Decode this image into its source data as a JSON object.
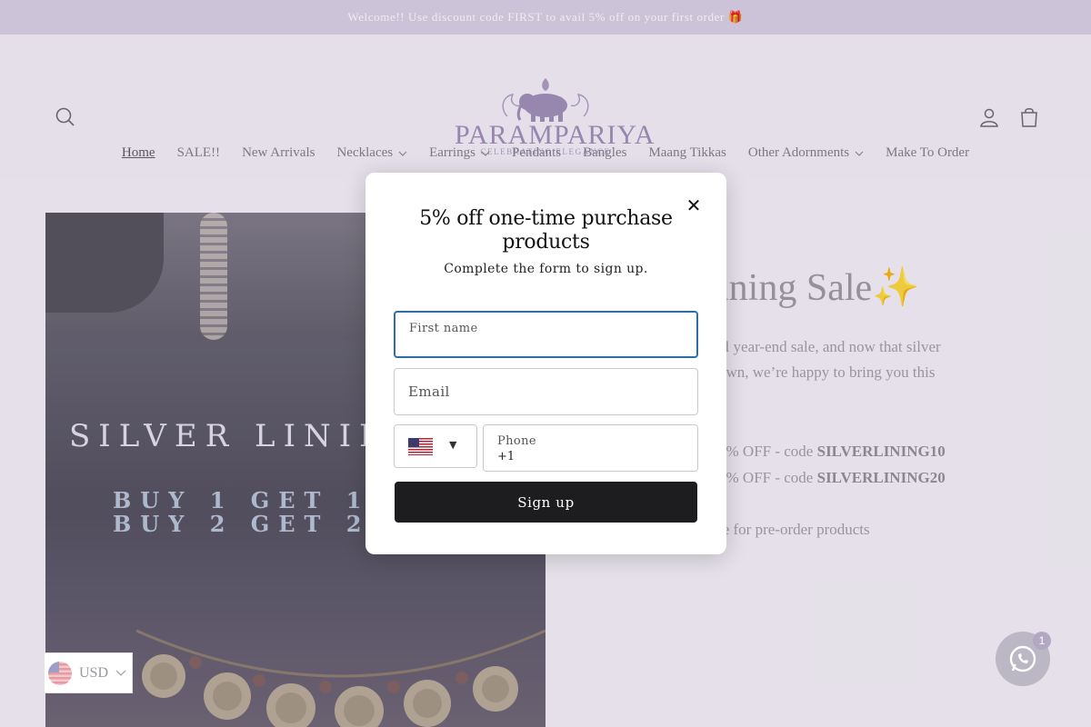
{
  "announcement": "Welcome!! Use discount code FIRST to avail 5% off on your first order 🎁",
  "header": {
    "brand": "PARAMPARIYA",
    "tagline": "CELEBRATING ELEGANCE",
    "icons": [
      "search-icon",
      "account-icon",
      "cart-icon"
    ]
  },
  "nav": {
    "items": [
      {
        "label": "Home",
        "active": true
      },
      {
        "label": "SALE!!"
      },
      {
        "label": "New Arrivals"
      },
      {
        "label": "Necklaces",
        "dropdown": true
      },
      {
        "label": "Earrings",
        "dropdown": true
      },
      {
        "label": "Pendants"
      },
      {
        "label": "Bangles"
      },
      {
        "label": "Maang Tikkas"
      },
      {
        "label": "Other Adornments",
        "dropdown": true
      },
      {
        "label": "Make To Order"
      }
    ]
  },
  "banner": {
    "title": "SILVER LINING",
    "offer_line1": "BUY 1 GET 10",
    "offer_line2": "BUY 2 GET 20"
  },
  "sale": {
    "title": "ining Sale✨",
    "line1": "al year-end sale, and now that silver",
    "line2": "own, we’re happy to bring you this",
    "code1_prefix": "0% OFF - code ",
    "code1": "SILVERLINING10",
    "code2_prefix": "0% OFF - code ",
    "code2": "SILVERLINING20",
    "note": "le for pre-order products"
  },
  "modal": {
    "title": "5% off one-time purchase products",
    "subtitle": "Complete the form to sign up.",
    "first_name_label": "First name",
    "email_label": "Email",
    "phone_label": "Phone",
    "phone_value": "+1",
    "country": "US",
    "caret": "▼",
    "submit_label": "Sign up",
    "close": "✕"
  },
  "currency": {
    "code": "USD"
  },
  "chat": {
    "badge": "1"
  },
  "colors": {
    "announcement_bg": "#d9d0e4",
    "header_bg": "#f3eff8",
    "button_dark": "#1d1d1f",
    "focus_border": "#2b6ea8"
  }
}
